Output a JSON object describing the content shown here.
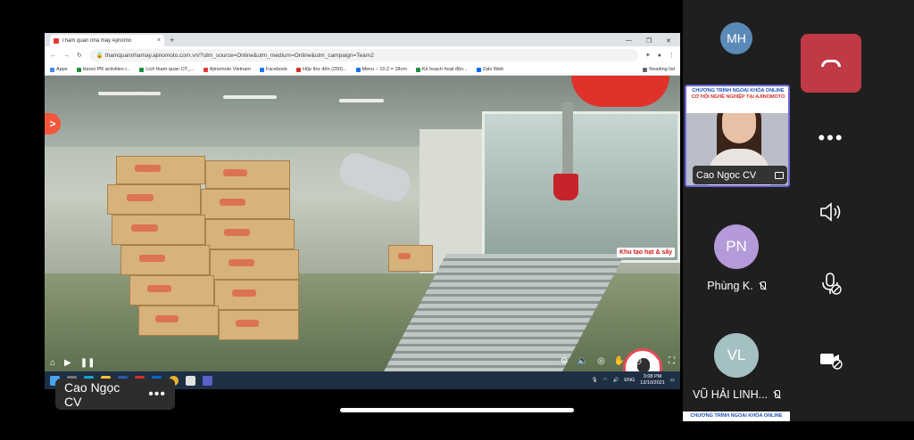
{
  "browser": {
    "tab_title": "Tham quan nhà máy Ajinomo",
    "tab_close": "×",
    "new_tab": "+",
    "url": "thamquannhamay.ajinomoto.com.vn/?utm_source=Online&utm_medium=Online&utm_campaign=Team2",
    "bookmarks": [
      "Apps",
      "Hanoi PR activities r...",
      "Lich tham quan OT_...",
      "Ajinomoto Vietnam",
      "Facebook",
      "Hộp thư đến (250)...",
      "Menu – 10.2 = 18cm",
      "Kế hoạch hoạt độn...",
      "Zalo Web"
    ],
    "reading_list": "Reading list"
  },
  "video": {
    "hotspot_label": ">",
    "area_label": "Khu tạo hạt & sấy"
  },
  "taskbar": {
    "lang": "ENG",
    "time": "3:08 PM",
    "date": "12/10/2021"
  },
  "speaker_bar": {
    "name": "Cao Ngọc CV",
    "more": "•••"
  },
  "participants": [
    {
      "initials": "MH",
      "color": "#5b8ab8"
    },
    {
      "initials": "PN",
      "name": "Phùng K.",
      "color": "#b49ad9"
    },
    {
      "initials": "VL",
      "name": "VŨ HẢI LINH...",
      "color": "#a4c0c2"
    }
  ],
  "active_video": {
    "name": "Cao Ngọc CV",
    "banner_line1": "CHƯƠNG TRÌNH NGOẠI KHÓA ONLINE",
    "banner_line2": "CƠ HỘI NGHỀ NGHIỆP TẠI AJINOMOTO"
  },
  "preview_strip": "CHƯƠNG TRÌNH NGOẠI KHÓA ONLINE",
  "controls": {
    "more": "•••"
  }
}
